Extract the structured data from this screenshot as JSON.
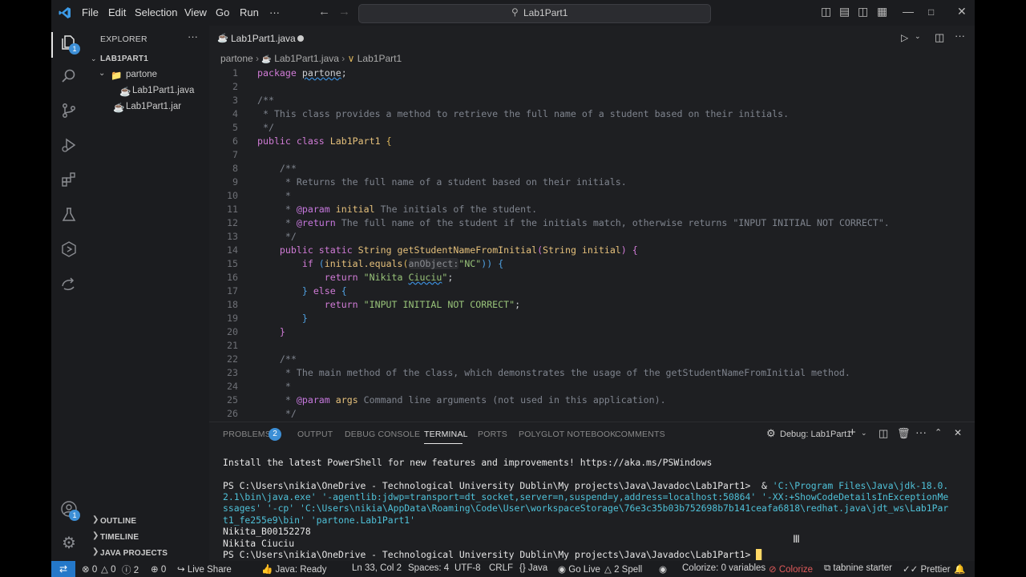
{
  "titlebar": {
    "menu": [
      "File",
      "Edit",
      "Selection",
      "View",
      "Go",
      "Run",
      "···"
    ],
    "search_text": "Lab1Part1"
  },
  "activity": {
    "explorer_badge": "1",
    "account_badge": "1"
  },
  "sidebar": {
    "title": "EXPLORER",
    "more": "···",
    "project": "LAB1PART1",
    "folder": "partone",
    "file_java": "Lab1Part1.java",
    "file_jar": "Lab1Part1.jar",
    "outline": "OUTLINE",
    "timeline": "TIMELINE",
    "java_projects": "JAVA PROJECTS"
  },
  "editor": {
    "tab_label": "Lab1Part1.java",
    "breadcrumb": [
      "partone",
      "Lab1Part1.java",
      "Lab1Part1"
    ],
    "lines": [
      "1",
      "2",
      "3",
      "4",
      "5",
      "6",
      "7",
      "8",
      "9",
      "10",
      "11",
      "12",
      "13",
      "14",
      "15",
      "16",
      "17",
      "18",
      "19",
      "20",
      "21",
      "22",
      "23",
      "24",
      "25",
      "26"
    ],
    "code": {
      "l1_kw": "package",
      "l1_pkg": "partone",
      "l1_end": ";",
      "l3": "/**",
      "l4": " * This class provides a method to retrieve the full name of a student based on their initials.",
      "l5": " */",
      "l6_a": "public",
      "l6_b": "class",
      "l6_c": "Lab1Part1",
      "l6_d": "{",
      "l8": "    /**",
      "l9": "     * Returns the full name of a student based on their initials.",
      "l10": "     *",
      "l11_a": "     * ",
      "l11_tag": "@param",
      "l11_p": "initial",
      "l11_rest": " The initials of the student.",
      "l12_a": "     * ",
      "l12_tag": "@return",
      "l12_rest": " The full name of the student if the initials match, otherwise returns \"INPUT INITIAL NOT CORRECT\".",
      "l13": "     */",
      "l14_a": "public",
      "l14_b": "static",
      "l14_c": "String",
      "l14_d": "getStudentNameFromInitial",
      "l14_e": "(",
      "l14_f": "String",
      "l14_g": "initial",
      "l14_h": ")",
      "l14_i": "{",
      "l15_a": "if",
      "l15_b": "(",
      "l15_c": "initial",
      "l15_d": ".equals",
      "l15_e": "(",
      "l15_hint": "anObject:",
      "l15_str": "\"NC\"",
      "l15_f": "))",
      "l15_g": "{",
      "l16_a": "return",
      "l16_str1": "\"Nikita ",
      "l16_str2": "Ciuciu",
      "l16_str3": "\"",
      "l16_end": ";",
      "l17_a": "}",
      "l17_b": "else",
      "l17_c": "{",
      "l18_a": "return",
      "l18_str": "\"INPUT INITIAL NOT CORRECT\"",
      "l18_end": ";",
      "l19": "}",
      "l20": "}",
      "l22": "    /**",
      "l23": "     * The main method of the class, which demonstrates the usage of the getStudentNameFromInitial method.",
      "l24": "     *",
      "l25_a": "     * ",
      "l25_tag": "@param",
      "l25_p": "args",
      "l25_rest": " Command line arguments (not used in this application).",
      "l26": "     */"
    }
  },
  "panel": {
    "tabs": [
      "PROBLEMS",
      "OUTPUT",
      "DEBUG CONSOLE",
      "TERMINAL",
      "PORTS",
      "POLYGLOT NOTEBOOK",
      "COMMENTS"
    ],
    "problems_count": "2",
    "debug_session": "Debug: Lab1Part1",
    "terminal": {
      "l1": "Install the latest PowerShell for new features and improvements! https://aka.ms/PSWindows",
      "l2_prompt": "PS C:\\Users\\nikia\\OneDrive - Technological University Dublin\\My projects\\Java\\Javadoc\\Lab1Part1>  & ",
      "l2_cmd": "'C:\\Program Files\\Java\\jdk-18.0.",
      "l3": "2.1\\bin\\java.exe' '-agentlib:jdwp=transport=dt_socket,server=n,suspend=y,address=localhost:50864' '-XX:+ShowCodeDetailsInExceptionMe",
      "l4": "ssages' '-cp' 'C:\\Users\\nikia\\AppData\\Roaming\\Code\\User\\workspaceStorage\\76e3c35b03b752698b7b141ceafa6818\\redhat.java\\jdt_ws\\Lab1Par",
      "l5": "t1_fe255e9\\bin' 'partone.Lab1Part1'",
      "l6": "Nikita_B00152278",
      "l7": "Nikita Ciuciu",
      "l8": "PS C:\\Users\\nikia\\OneDrive - Technological University Dublin\\My projects\\Java\\Javadoc\\Lab1Part1> "
    }
  },
  "status": {
    "errors": "0",
    "warnings": "0",
    "info": "2",
    "ports": "0",
    "live_share": "Live Share",
    "java_ready": "Java: Ready",
    "position": "Ln 33, Col 2",
    "spaces": "Spaces: 4",
    "encoding": "UTF-8",
    "eol": "CRLF",
    "language": "Java",
    "go_live": "Go Live",
    "spell": "2 Spell",
    "colorize_vars": "Colorize: 0 variables",
    "colorize": "Colorize",
    "tabnine": "tabnine starter",
    "prettier": "Prettier"
  },
  "colors": {
    "accent": "#2478c9",
    "badge": "#3d8fd6",
    "background": "#1e1f22"
  }
}
